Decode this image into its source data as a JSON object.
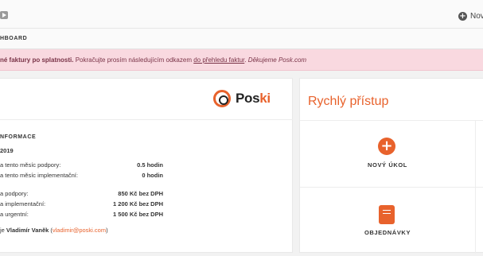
{
  "topbar": {
    "youtube_icon": "youtube-icon",
    "new_label": "Nový",
    "plus_icon": "plus-circle-icon"
  },
  "breadcrumb": "HBOARD",
  "alert": {
    "bold_text": "né faktury po splatnosti.",
    "text": " Pokračujte prosím následujícím odkazem ",
    "link_text": "do přehledu faktur",
    "text2": ". ",
    "thanks": "Děkujeme Posk.com"
  },
  "logo": {
    "text_main": "Pos",
    "text_accent": "ki"
  },
  "info": {
    "heading": "NFORMACE",
    "year": "2019",
    "rows": [
      {
        "label": "a tento měsíc podpory:",
        "value": "0.5 hodin"
      },
      {
        "label": "a tento měsíc implementační:",
        "value": "0 hodin"
      },
      {
        "label": "a podpory:",
        "value": "850 Kč bez DPH"
      },
      {
        "label": "a implementační:",
        "value": "1 200 Kč bez DPH"
      },
      {
        "label": "a urgentní:",
        "value": "1 500 Kč bez DPH"
      }
    ],
    "contact_prefix": "je ",
    "contact_name": "Vladimír Vaněk",
    "contact_email": "vladimir@poski.com",
    "contact_open": " (",
    "contact_close": ")"
  },
  "quick_access": {
    "title": "Rychlý přístup",
    "tiles": [
      {
        "label": "NOVÝ ÚKOL",
        "icon": "add-circle-icon"
      },
      {
        "label": "OBJEDNÁVKY",
        "icon": "book-icon"
      }
    ]
  },
  "colors": {
    "accent": "#e8622c",
    "alert_bg": "#f9d9e0",
    "alert_text": "#7a3448"
  }
}
